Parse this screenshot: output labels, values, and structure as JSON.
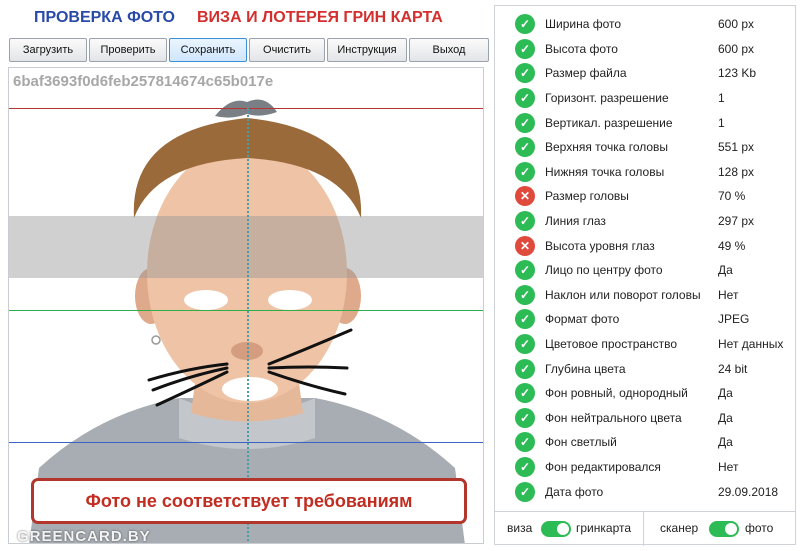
{
  "header": {
    "title_left": "ПРОВЕРКА ФОТО",
    "title_right": "ВИЗА И ЛОТЕРЕЯ ГРИН КАРТА"
  },
  "toolbar": {
    "buttons": [
      {
        "label": "Загрузить"
      },
      {
        "label": "Проверить"
      },
      {
        "label": "Сохранить",
        "active": true
      },
      {
        "label": "Очистить"
      },
      {
        "label": "Инструкция"
      },
      {
        "label": "Выход"
      }
    ]
  },
  "photo": {
    "hash": "6baf3693f0d6feb257814674c65b017e",
    "warning": "Фото не соответствует требованиям",
    "watermark": "GREENCARD.BY"
  },
  "checks": [
    {
      "label": "Ширина фото",
      "value": "600 px",
      "status": "ok"
    },
    {
      "label": "Высота фото",
      "value": "600 px",
      "status": "ok"
    },
    {
      "label": "Размер файла",
      "value": "123 Kb",
      "status": "ok"
    },
    {
      "label": "Горизонт. разрешение",
      "value": "1",
      "status": "ok"
    },
    {
      "label": "Вертикал. разрешение",
      "value": "1",
      "status": "ok"
    },
    {
      "label": "Верхняя точка головы",
      "value": "551 px",
      "status": "ok"
    },
    {
      "label": "Нижняя точка головы",
      "value": "128 px",
      "status": "ok"
    },
    {
      "label": "Размер головы",
      "value": "70 %",
      "status": "error"
    },
    {
      "label": "Линия глаз",
      "value": "297 px",
      "status": "ok"
    },
    {
      "label": "Высота уровня глаз",
      "value": "49 %",
      "status": "error"
    },
    {
      "label": "Лицо по центру фото",
      "value": "Да",
      "status": "ok"
    },
    {
      "label": "Наклон или поворот головы",
      "value": "Нет",
      "status": "ok"
    },
    {
      "label": "Формат фото",
      "value": "JPEG",
      "status": "ok"
    },
    {
      "label": "Цветовое пространство",
      "value": "Нет данных",
      "status": "ok"
    },
    {
      "label": "Глубина цвета",
      "value": "24 bit",
      "status": "ok"
    },
    {
      "label": "Фон ровный, однородный",
      "value": "Да",
      "status": "ok"
    },
    {
      "label": "Фон нейтрального цвета",
      "value": "Да",
      "status": "ok"
    },
    {
      "label": "Фон светлый",
      "value": "Да",
      "status": "ok"
    },
    {
      "label": "Фон редактировался",
      "value": "Нет",
      "status": "ok"
    },
    {
      "label": "Дата фото",
      "value": "29.09.2018",
      "status": "ok"
    }
  ],
  "toggles": {
    "left_label": "виза",
    "left_right_label": "гринкарта",
    "left_on": true,
    "right_label": "сканер",
    "right_right_label": "фото",
    "right_on": true
  },
  "colors": {
    "ok": "#2dbb55",
    "error": "#e04a3d",
    "title_blue": "#2a4aa8",
    "title_red": "#d32f2f"
  }
}
